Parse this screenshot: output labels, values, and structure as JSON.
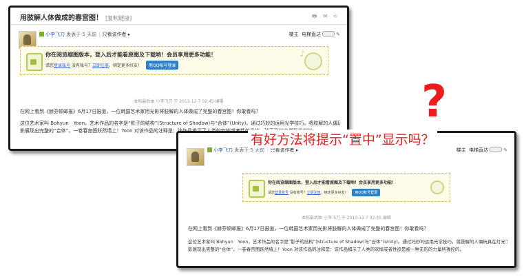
{
  "post": {
    "title": "用肢解人体做成的春宫图！",
    "copy_link": "[复制链接]",
    "title_icons": "🖶 ✉ ➪",
    "author": "小李飞刀",
    "posted": "发表于 5 天前",
    "only_author": "只看该作者 ▸",
    "floor": "楼主",
    "elevator": "电梯直达",
    "notice_title": "你在阅览缩图版本，登入后才能看原图及下载哟！会员享用更多功能！",
    "notice_prefix": "请您",
    "login_link": "登录账号",
    "no_account": "没有账号？",
    "register_link": "立即注册",
    "invite": "，绑定更多好友！",
    "qq_login": "用QQ帐号登录",
    "edit_note": "本帖最后由 小李飞刀 于 2013-12-7 02:45 编辑",
    "para1": "在网上看到《赫芬顿邮报》6月17日报道，一位韩国艺术家用光影将肢解的人体做成了完整的春宫图！你敢看吗？",
    "para2": "这位艺术家叫 Bohyun　Yoon，艺术作品的名字是“影子的结构”(Structure of Shadow)与“合体”(Unity)。通过巧妙的运用光学技巧，将肢解的人偶玩具在灯光下投",
    "para3": "影展现出完整的“合体”，一卷春宫图跃然墙上！Yoon 对该作品的注释是：该作品揭示了人类的欢愉或者性欲是被一种无形的力量所操控的。"
  },
  "annotation": {
    "question_mark": "?",
    "question": "有好方法将提示“置中”显示吗？"
  },
  "colors": {
    "accent_red": "#ee1c1c",
    "link_blue": "#3366cc",
    "qq_blue": "#2f7fc4"
  },
  "icons": [
    "print-icon",
    "lock-icon",
    "music-icon",
    "wrench-icon",
    "avatar"
  ]
}
